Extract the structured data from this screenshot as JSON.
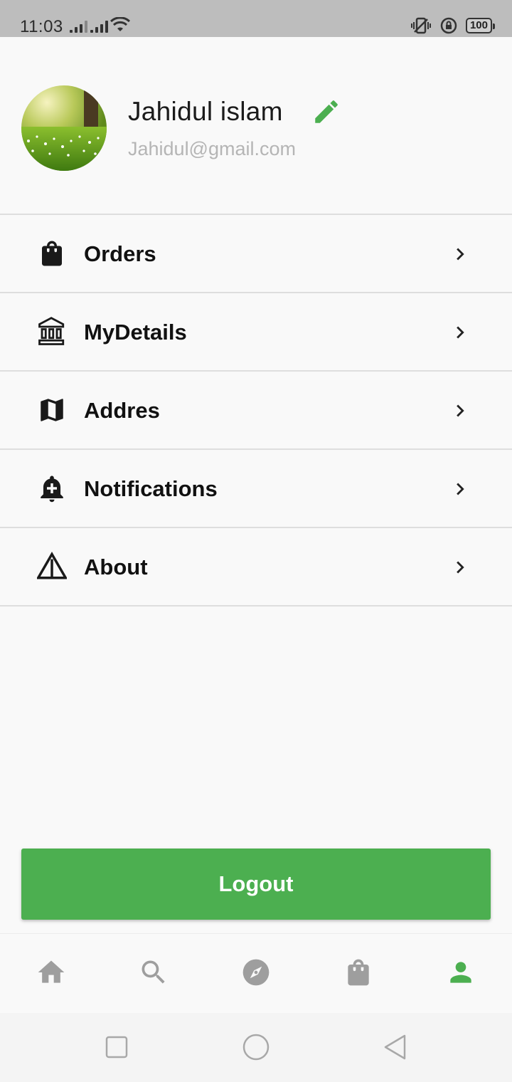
{
  "status_bar": {
    "time": "11:03",
    "battery": "100"
  },
  "profile": {
    "name": "Jahidul islam",
    "email": "Jahidul@gmail.com",
    "edit_icon": "pencil-icon",
    "accent_color": "#4caf50"
  },
  "menu": {
    "items": [
      {
        "label": "Orders",
        "icon": "shopping-bag-icon"
      },
      {
        "label": "MyDetails",
        "icon": "bank-icon"
      },
      {
        "label": "Addres",
        "icon": "map-icon"
      },
      {
        "label": "Notifications",
        "icon": "add-alert-icon"
      },
      {
        "label": "About",
        "icon": "warning-triangle-icon"
      }
    ]
  },
  "logout": {
    "label": "Logout",
    "color": "#4caf50"
  },
  "bottom_nav": {
    "items": [
      {
        "icon": "home-icon",
        "active": false
      },
      {
        "icon": "search-icon",
        "active": false
      },
      {
        "icon": "compass-icon",
        "active": false
      },
      {
        "icon": "shopping-bag-icon",
        "active": false
      },
      {
        "icon": "person-icon",
        "active": true
      }
    ],
    "active_color": "#4caf50",
    "inactive_color": "#9e9e9e"
  },
  "system_nav": {
    "buttons": [
      "recent-apps-icon",
      "home-circle-icon",
      "back-triangle-icon"
    ]
  }
}
